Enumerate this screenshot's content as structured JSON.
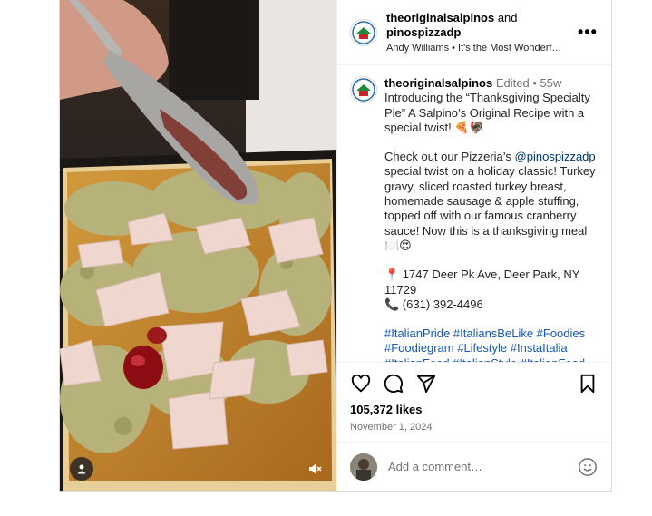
{
  "header": {
    "username_primary": "theoriginalsalpinos",
    "joiner": "and",
    "username_collab": "pinospizzadp",
    "audio": "Andy Williams • It's the Most Wonderf…",
    "more_label": "•••"
  },
  "caption": {
    "username": "theoriginalsalpinos",
    "edited": "Edited",
    "time": "55w",
    "intro": "Introducing the “Thanksgiving Specialty Pie” A Salpino’s Original Recipe with a special twist! 🍕🦃",
    "para2_before": "Check out our Pizzeria’s ",
    "para2_mention": "@pinospizzadp",
    "para2_after": " special twist on a holiday classic! Turkey gravy, sliced roasted turkey breast, homemade sausage & apple stuffing, topped off with our famous cranberry sauce! Now this is a thanksgiving meal 🍽️😍",
    "address": "📍 1747 Deer Pk Ave, Deer Park, NY 11729",
    "phone": "📞 (631) 392-4496",
    "hashtags": "#ItalianPride #ItaliansBeLike #Foodies #Foodiegram #Lifestyle #InstaItalia #ItalianFood #ItalianStyle #ItalianFood"
  },
  "stats": {
    "likes": "105,372 likes",
    "date": "November 1, 2024"
  },
  "comment": {
    "placeholder": "Add a comment…"
  },
  "icons": {
    "like": "heart-icon",
    "comment": "comment-icon",
    "share": "share-icon",
    "save": "bookmark-icon",
    "emoji": "smiley-icon",
    "tags": "person-tag-icon",
    "mute": "speaker-muted-icon"
  },
  "colors": {
    "link": "#00376b",
    "hashtag": "#1a57b7",
    "secondary_text": "#737373",
    "border": "#dbdbdb"
  }
}
